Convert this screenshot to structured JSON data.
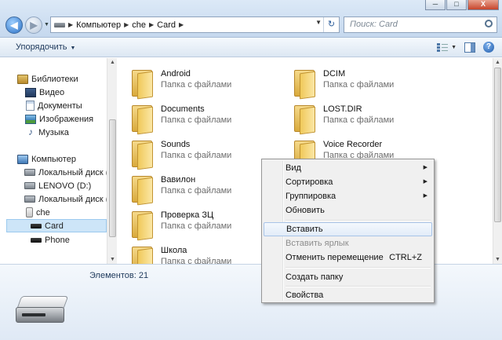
{
  "window": {
    "minimize": "─",
    "maximize": "□",
    "close": "X"
  },
  "address": {
    "crumbs": [
      "Компьютер",
      "che",
      "Card"
    ],
    "refresh": "↻"
  },
  "search": {
    "placeholder": "Поиск: Card"
  },
  "command_bar": {
    "organize": "Упорядочить"
  },
  "nav": {
    "libraries": "Библиотеки",
    "video": "Видео",
    "documents": "Документы",
    "images": "Изображения",
    "music": "Музыка",
    "computer": "Компьютер",
    "local_disk_c": "Локальный диск (C",
    "lenovo": "LENOVO (D:)",
    "local_disk_q": "Локальный диск (Q",
    "che": "che",
    "card": "Card",
    "phone": "Phone"
  },
  "folders": [
    {
      "name": "Android",
      "type": "Папка с файлами"
    },
    {
      "name": "DCIM",
      "type": "Папка с файлами"
    },
    {
      "name": "Documents",
      "type": "Папка с файлами"
    },
    {
      "name": "LOST.DIR",
      "type": "Папка с файлами"
    },
    {
      "name": "Sounds",
      "type": "Папка с файлами"
    },
    {
      "name": "Voice Recorder",
      "type": "Папка с файлами"
    },
    {
      "name": "Вавилон",
      "type": "Папка с файлами"
    },
    {
      "name": "Проверка ЗЦ",
      "type": "Папка с файлами"
    },
    {
      "name": "Школа",
      "type": "Папка с файлами"
    }
  ],
  "details": {
    "count": "Элементов: 21"
  },
  "context_menu": {
    "view": "Вид",
    "sort": "Сортировка",
    "group": "Группировка",
    "refresh": "Обновить",
    "paste": "Вставить",
    "paste_shortcut": "Вставить ярлык",
    "undo_move": "Отменить перемещение",
    "undo_move_key": "CTRL+Z",
    "new_folder": "Создать папку",
    "properties": "Свойства"
  },
  "colors": {
    "accent": "#2a6fc4",
    "folder": "#f0c95a",
    "selection": "#cde5f8"
  },
  "icons": [
    "back-icon",
    "forward-icon",
    "drive-icon",
    "refresh-icon",
    "search-icon",
    "views-icon",
    "preview-pane-icon",
    "help-icon",
    "folder-icon",
    "library-icon",
    "computer-icon",
    "disk-icon",
    "phone-icon",
    "card-icon"
  ]
}
